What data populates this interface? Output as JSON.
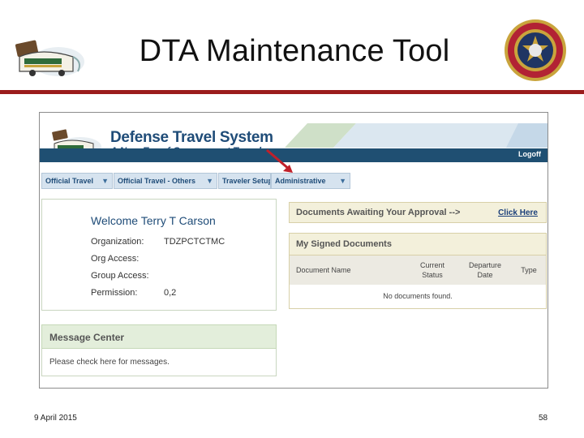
{
  "slide": {
    "title": "DTA Maintenance Tool",
    "date": "9 April 2015",
    "page_number": "58"
  },
  "dts": {
    "name": "Defense Travel System",
    "tagline": "A New Era of Government Travel",
    "logoff": "Logoff"
  },
  "nav": [
    {
      "label": "Official Travel"
    },
    {
      "label": "Official Travel - Others"
    },
    {
      "label": "Traveler Setup"
    },
    {
      "label": "Administrative"
    }
  ],
  "welcome": {
    "greeting": "Welcome Terry T Carson",
    "fields": [
      {
        "label": "Organization:",
        "value": "TDZPCTCTMC"
      },
      {
        "label": "Org Access:",
        "value": ""
      },
      {
        "label": "Group Access:",
        "value": ""
      },
      {
        "label": "Permission:",
        "value": "0,2"
      }
    ]
  },
  "message_center": {
    "title": "Message Center",
    "link_text": "Please check here for messages."
  },
  "approvals": {
    "text": "Documents Awaiting Your Approval -->",
    "link": "Click Here"
  },
  "signed_documents": {
    "title": "My Signed Documents",
    "columns": [
      "Document Name",
      "Current Status",
      "Departure Date",
      "Type"
    ],
    "empty_text": "No documents found."
  },
  "colors": {
    "slide_rule": "#9b1c1c",
    "dts_blue": "#1f4c78",
    "header_bar": "#1f4f72",
    "annotation_arrow": "#c0202a"
  },
  "icons": {
    "slide_logo": "dts-bus-logo-icon",
    "seal": "usmc-seal-icon",
    "nav_dropdown": "triangle-down-icon",
    "annotation": "red-arrow-icon"
  }
}
